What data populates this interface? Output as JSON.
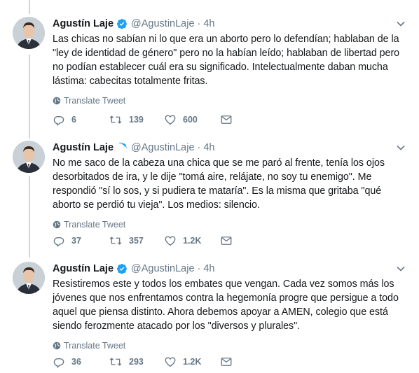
{
  "tweets": [
    {
      "name": "Agustín Laje",
      "handle": "@AgustinLaje",
      "separator": "·",
      "time": "4h",
      "text": "Las chicas no sabían ni lo que era un aborto pero lo defendían; hablaban de la \"ley de identidad de género\" pero no la habían leído; hablaban de libertad pero no podían establecer cuál era su significado. Intelectualmente daban mucha lástima: cabecitas totalmente fritas.",
      "translate_label": "Translate Tweet",
      "replies": "6",
      "retweets": "139",
      "likes": "600"
    },
    {
      "name": "Agustín Laje",
      "handle": "@AgustinLaje",
      "separator": "·",
      "time": "4h",
      "text": "No me saco de la cabeza una chica que se me paró al frente, tenía los ojos desorbitados de ira, y le dije \"tomá aire, relájate, no soy tu enemigo\". Me respondió \"sí lo sos, y si pudiera te mataría\". Es la misma que gritaba \"qué aborto se perdió tu vieja\". Los medios: silencio.",
      "translate_label": "Translate Tweet",
      "replies": "37",
      "retweets": "357",
      "likes": "1.2K"
    },
    {
      "name": "Agustín Laje",
      "handle": "@AgustinLaje",
      "separator": "·",
      "time": "4h",
      "text": "Resistiremos este y todos los embates que vengan. Cada vez somos más los jóvenes que nos enfrentamos contra la hegemonía progre que persigue a todo aquel que piensa distinto. Ahora debemos apoyar a AMEN, colegio que está siendo ferozmente atacado por los \"diversos y plurales\".",
      "translate_label": "Translate Tweet",
      "replies": "36",
      "retweets": "293",
      "likes": "1.2K"
    }
  ],
  "colors": {
    "text": "#14171a",
    "secondary": "#657786",
    "verified": "#1da1f2",
    "thread_line": "#ccd6dd"
  },
  "icons": [
    "verified-badge-icon",
    "caret-down-icon",
    "globe-icon",
    "reply-icon",
    "retweet-icon",
    "like-icon",
    "direct-message-icon"
  ]
}
